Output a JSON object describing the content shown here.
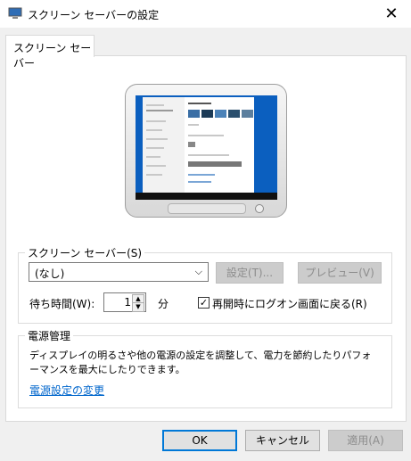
{
  "window": {
    "title": "スクリーン セーバーの設定",
    "close_glyph": "✕"
  },
  "tab": {
    "label": "スクリーン セーバー"
  },
  "screensaver": {
    "group_label": "スクリーン セーバー(S)",
    "selected": "(なし)",
    "settings_button": "設定(T)...",
    "preview_button": "プレビュー(V)",
    "wait_label": "待ち時間(W):",
    "wait_value": "1",
    "wait_unit": "分",
    "resume_checkbox_label": "再開時にログオン画面に戻る(R)",
    "resume_checked": true
  },
  "power": {
    "group_label": "電源管理",
    "description_line1": "ディスプレイの明るさや他の電源の設定を調整して、電力を節約したりパフォ",
    "description_line2": "ーマンスを最大にしたりできます。",
    "link": "電源設定の変更"
  },
  "buttons": {
    "ok": "OK",
    "cancel": "キャンセル",
    "apply": "適用(A)"
  },
  "icons": {
    "app": "monitor-icon",
    "close": "close-icon",
    "chevron": "chevron-down-icon",
    "check": "checkmark-icon"
  },
  "colors": {
    "accent": "#0078d7",
    "link": "#0066cc",
    "desktop": "#0b5fbf"
  }
}
